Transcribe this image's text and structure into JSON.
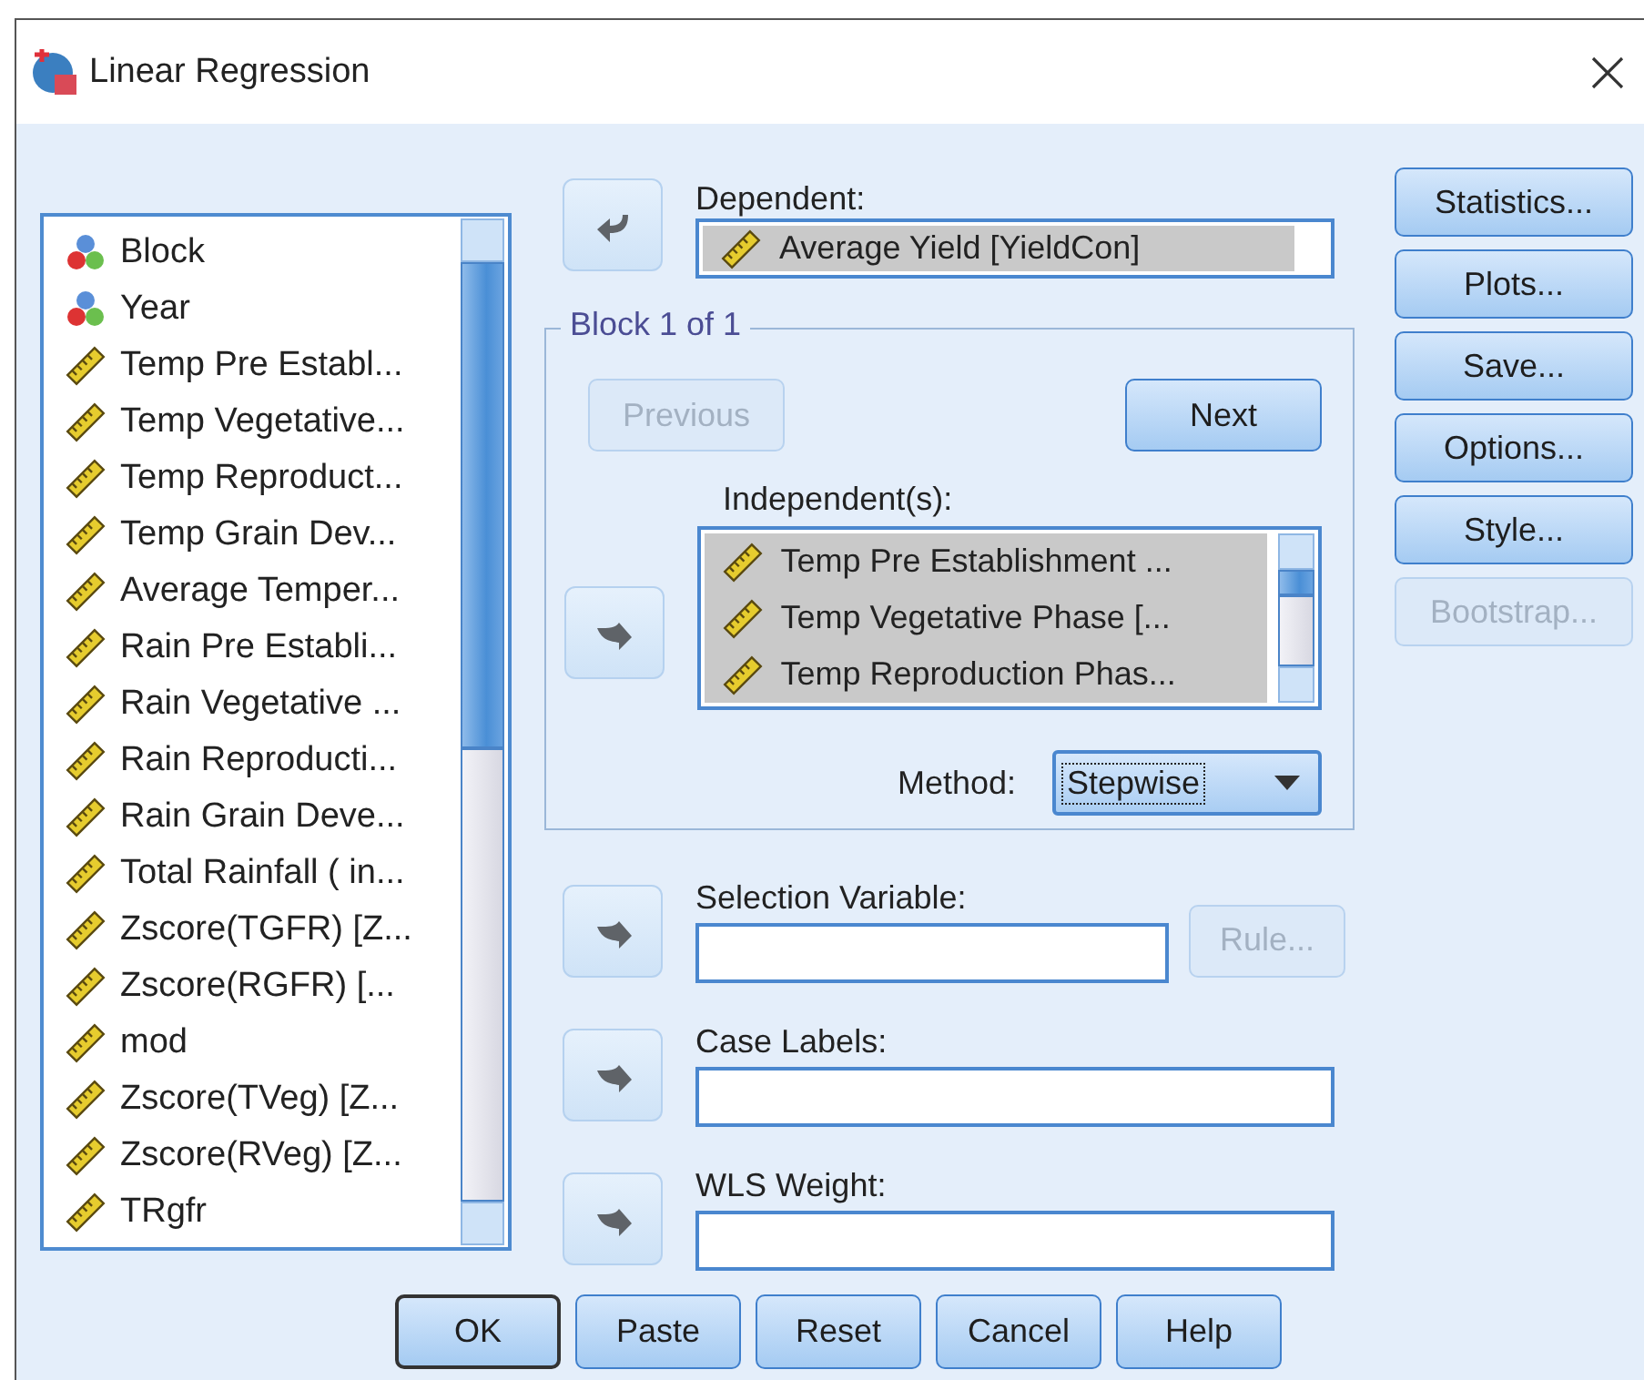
{
  "window": {
    "title": "Linear Regression"
  },
  "variables": [
    {
      "label": "Block",
      "kind": "nominal"
    },
    {
      "label": "Year",
      "kind": "nominal"
    },
    {
      "label": "Temp Pre Establ...",
      "kind": "scale"
    },
    {
      "label": "Temp Vegetative...",
      "kind": "scale"
    },
    {
      "label": "Temp Reproduct...",
      "kind": "scale"
    },
    {
      "label": "Temp Grain Dev...",
      "kind": "scale"
    },
    {
      "label": "Average Temper...",
      "kind": "scale"
    },
    {
      "label": "Rain Pre Establi...",
      "kind": "scale"
    },
    {
      "label": "Rain Vegetative ...",
      "kind": "scale"
    },
    {
      "label": "Rain Reproducti...",
      "kind": "scale"
    },
    {
      "label": "Rain Grain Deve...",
      "kind": "scale"
    },
    {
      "label": "Total Rainfall ( in...",
      "kind": "scale"
    },
    {
      "label": "Zscore(TGFR) [Z...",
      "kind": "scale"
    },
    {
      "label": "Zscore(RGFR) [...",
      "kind": "scale"
    },
    {
      "label": "mod",
      "kind": "scale"
    },
    {
      "label": "Zscore(TVeg) [Z...",
      "kind": "scale"
    },
    {
      "label": "Zscore(RVeg) [Z...",
      "kind": "scale"
    },
    {
      "label": "TRgfr",
      "kind": "scale"
    }
  ],
  "dependent": {
    "label": "Dependent:",
    "value": {
      "label": "Average Yield [YieldCon]",
      "kind": "scale"
    }
  },
  "block": {
    "title": "Block 1 of 1",
    "previous": {
      "label": "Previous",
      "disabled": true
    },
    "next": {
      "label": "Next",
      "disabled": false
    },
    "independents": {
      "label": "Independent(s):",
      "items": [
        {
          "label": "Temp Pre Establishment ...",
          "kind": "scale"
        },
        {
          "label": "Temp Vegetative Phase [...",
          "kind": "scale"
        },
        {
          "label": "Temp Reproduction Phas...",
          "kind": "scale"
        }
      ]
    },
    "method": {
      "label": "Method:",
      "value": "Stepwise",
      "focused": true
    }
  },
  "selection_variable": {
    "label": "Selection Variable:",
    "rule": {
      "label": "Rule...",
      "disabled": true
    }
  },
  "case_labels": {
    "label": "Case Labels:"
  },
  "wls_weight": {
    "label": "WLS Weight:"
  },
  "side_buttons": [
    {
      "label": "Statistics...",
      "disabled": false
    },
    {
      "label": "Plots...",
      "disabled": false
    },
    {
      "label": "Save...",
      "disabled": false
    },
    {
      "label": "Options...",
      "disabled": false
    },
    {
      "label": "Style...",
      "disabled": false
    },
    {
      "label": "Bootstrap...",
      "disabled": true
    }
  ],
  "footer_buttons": [
    {
      "label": "OK",
      "default": true
    },
    {
      "label": "Paste",
      "default": false
    },
    {
      "label": "Reset",
      "default": false
    },
    {
      "label": "Cancel",
      "default": false
    },
    {
      "label": "Help",
      "default": false
    }
  ]
}
